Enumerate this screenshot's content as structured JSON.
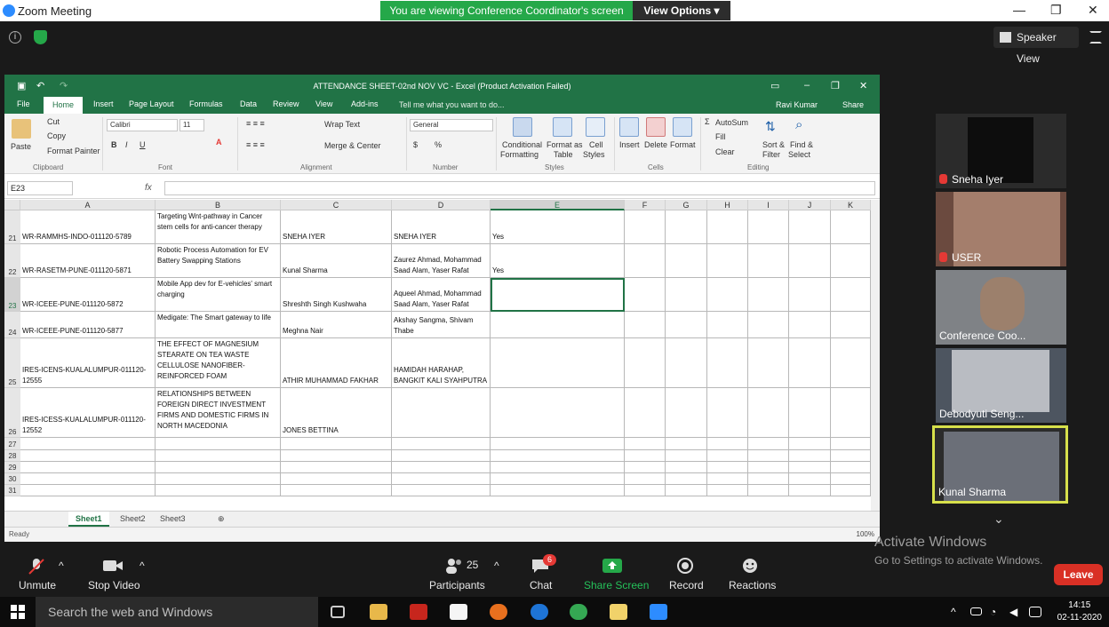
{
  "window": {
    "title": "Zoom Meeting",
    "banner": "You are viewing Conference Coordinator's screen",
    "view_options": "View Options ▾",
    "min": "—",
    "max": "❐",
    "close": "✕"
  },
  "zoom_top": {
    "speaker_view": "Speaker View",
    "info": "i"
  },
  "excel": {
    "caption": "ATTENDANCE SHEET-02nd NOV VC  -  Excel (Product Activation Failed)",
    "user": "Ravi Kumar",
    "share": "Share",
    "tabs": [
      "File",
      "Home",
      "Insert",
      "Page Layout",
      "Formulas",
      "Data",
      "Review",
      "View",
      "Add-ins"
    ],
    "tell_me": "Tell me what you want to do...",
    "ribbon": {
      "paste": "Paste",
      "cut": "Cut",
      "copy": "Copy",
      "format_painter": "Format Painter",
      "clipboard": "Clipboard",
      "font_name": "Calibri",
      "font_size": "11",
      "font": "Font",
      "bold": "B",
      "italic": "I",
      "underline": "U",
      "wrap_text": "Wrap Text",
      "merge_center": "Merge & Center",
      "alignment": "Alignment",
      "number_format": "General",
      "number": "Number",
      "currency": "$",
      "percent": "%",
      "conditional": "Conditional",
      "formatting": "Formatting",
      "format_as": "Format as",
      "table": "Table",
      "cell": "Cell",
      "styles_lbl": "Styles",
      "styles": "Styles",
      "insert": "Insert",
      "delete": "Delete",
      "format": "Format",
      "cells": "Cells",
      "autosum": "AutoSum",
      "fill": "Fill",
      "clear": "Clear",
      "sort_filter": "Sort &",
      "filter": "Filter",
      "find_select": "Find &",
      "select": "Select",
      "editing": "Editing"
    },
    "name_box": "E23",
    "fx": "fx",
    "columns": [
      "A",
      "B",
      "C",
      "D",
      "E",
      "F",
      "G",
      "H",
      "I",
      "J",
      "K"
    ],
    "rows": [
      {
        "n": "21",
        "a": "WR-RAMMHS-INDO-011120-5789",
        "b": "Targeting Wnt-pathway in Cancer stem cells for anti-cancer therapy",
        "c": "SNEHA IYER",
        "d": "SNEHA IYER",
        "e": "Yes"
      },
      {
        "n": "22",
        "a": "WR-RASETM-PUNE-011120-5871",
        "b": "Robotic Process Automation for EV Battery Swapping Stations",
        "c": "Kunal Sharma",
        "d": "Zaurez Ahmad, Mohammad Saad Alam, Yaser Rafat",
        "e": "Yes"
      },
      {
        "n": "23",
        "a": "WR-ICEEE-PUNE-011120-5872",
        "b": "Mobile App dev for E-vehicles' smart charging",
        "c": "Shreshth Singh Kushwaha",
        "d": "Aqueel Ahmad, Mohammad Saad Alam, Yaser Rafat",
        "e": ""
      },
      {
        "n": "24",
        "a": "WR-ICEEE-PUNE-011120-5877",
        "b": "Medigate: The Smart gateway to life",
        "c": "Meghna Nair",
        "d": "Akshay Sangma, Shivam Thabe",
        "e": ""
      },
      {
        "n": "25",
        "a": "IRES-ICENS-KUALALUMPUR-011120-12555",
        "b": "THE EFFECT OF MAGNESIUM STEARATE ON TEA WASTE CELLULOSE NANOFIBER-REINFORCED FOAM",
        "c": "ATHIR MUHAMMAD FAKHAR",
        "d": "HAMIDAH HARAHAP, BANGKIT KALI SYAHPUTRA",
        "e": ""
      },
      {
        "n": "26",
        "a": "IRES-ICESS-KUALALUMPUR-011120-12552",
        "b": "RELATIONSHIPS BETWEEN FOREIGN DIRECT INVESTMENT FIRMS AND DOMESTIC FIRMS IN NORTH MACEDONIA",
        "c": "JONES BETTINA",
        "d": "",
        "e": ""
      },
      {
        "n": "27"
      },
      {
        "n": "28"
      },
      {
        "n": "29"
      },
      {
        "n": "30"
      },
      {
        "n": "31"
      }
    ],
    "sheets": [
      "Sheet1",
      "Sheet2",
      "Sheet3"
    ],
    "status": "Ready",
    "zoom": "100%"
  },
  "participants": [
    {
      "name": "Sneha Iyer",
      "muted": true
    },
    {
      "name": "USER",
      "muted": true
    },
    {
      "name": "Conference Coo...",
      "muted": false
    },
    {
      "name": "Debodyuti Seng...",
      "muted": false
    },
    {
      "name": "Kunal Sharma",
      "muted": false
    }
  ],
  "watermark": {
    "line1": "Activate Windows",
    "line2": "Go to Settings to activate Windows."
  },
  "toolbar": {
    "unmute": "Unmute",
    "stop_video": "Stop Video",
    "participants": "Participants",
    "participant_count": "25",
    "chat": "Chat",
    "chat_badge": "6",
    "share_screen": "Share Screen",
    "record": "Record",
    "reactions": "Reactions",
    "leave": "Leave"
  },
  "taskbar": {
    "search": "Search the web and Windows",
    "time": "14:15",
    "date": "02-11-2020"
  }
}
